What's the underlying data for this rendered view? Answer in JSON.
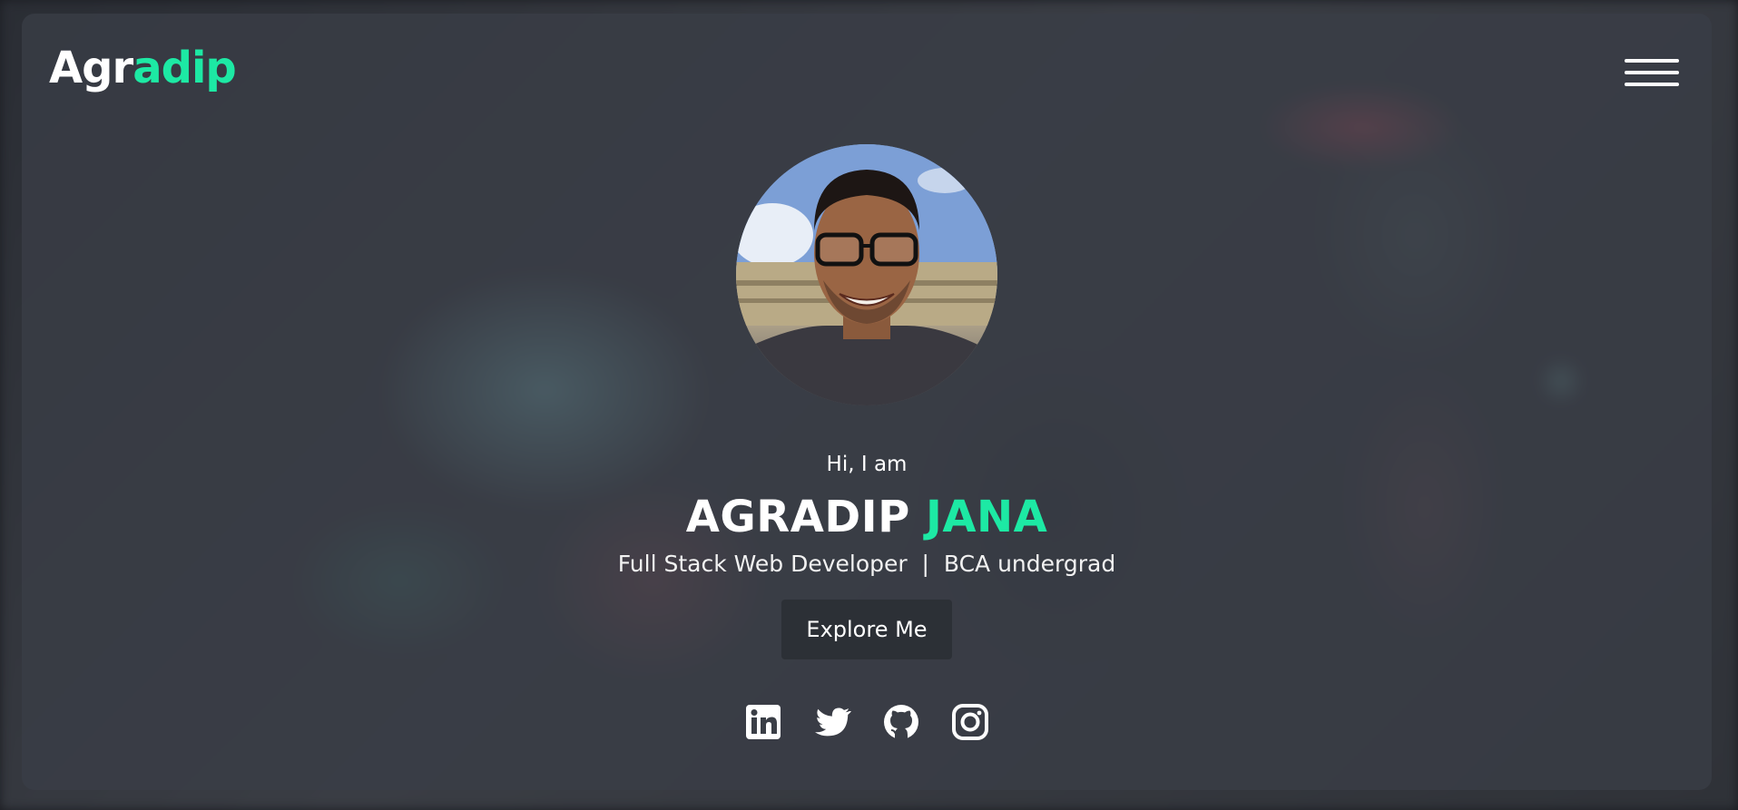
{
  "header": {
    "logo_part1": "Agr",
    "logo_part2": "adip",
    "menu_icon": "hamburger-menu-icon"
  },
  "hero": {
    "greeting": "Hi, I am",
    "first_name": "AGRADIP",
    "last_name": "JANA",
    "tagline": "Full Stack Web Developer  |  BCA undergrad",
    "cta_label": "Explore Me"
  },
  "socials": [
    {
      "icon": "linkedin-icon"
    },
    {
      "icon": "twitter-icon"
    },
    {
      "icon": "github-icon"
    },
    {
      "icon": "instagram-icon"
    }
  ],
  "colors": {
    "accent": "#1de9a4",
    "card": "#3a3e46",
    "text": "#ffffff"
  }
}
